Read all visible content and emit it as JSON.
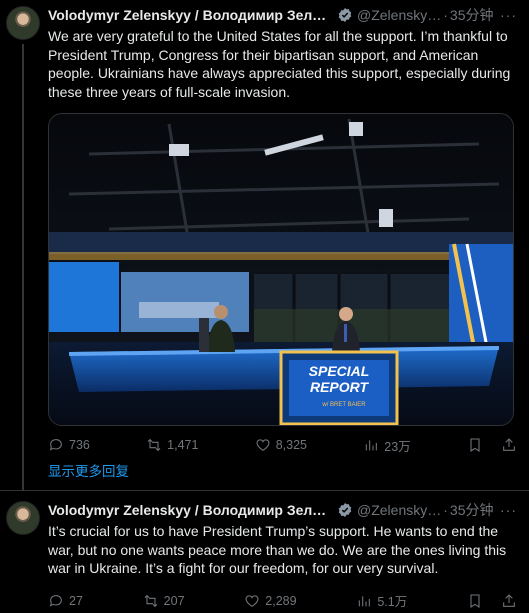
{
  "posts": [
    {
      "author_name": "Volodymyr Zelenskyy / Володимир Зелен…",
      "handle": "@Zelensky…",
      "dot": "·",
      "time": "35分钟",
      "more": "···",
      "text": "We are very grateful to the United States for all the support. I’m thankful to President Trump, Congress for their bipartisan support, and American people. Ukrainians have always appreciated this support, especially during these three years of full-scale invasion.",
      "media": {
        "studio_banner_line1": "SPECIAL",
        "studio_banner_line2": "REPORT",
        "studio_banner_line3": "w/ BRET BAIER"
      },
      "replies": "736",
      "reposts": "1,471",
      "likes": "8,325",
      "views": "23万"
    },
    {
      "author_name": "Volodymyr Zelenskyy / Володимир Зелен…",
      "handle": "@Zelensky…",
      "dot": "·",
      "time": "35分钟",
      "more": "···",
      "text": "It’s crucial for us to have President Trump’s support. He wants to end the war, but no one wants peace more than we do. We are the ones living this war in Ukraine. It’s a fight for our freedom, for our very survival.",
      "replies": "27",
      "reposts": "207",
      "likes": "2,289",
      "views": "5.1万"
    }
  ],
  "show_more_replies": "显示更多回复",
  "colors": {
    "accent": "#1d9bf0",
    "muted": "#71767b",
    "background": "#000000",
    "text": "#e7e9ea"
  }
}
